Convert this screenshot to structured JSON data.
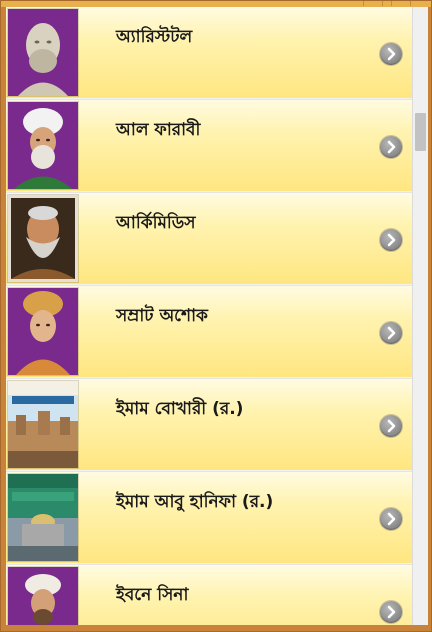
{
  "list": {
    "items": [
      {
        "label": "অ্যারিস্টটল",
        "thumb": "statue-portrait"
      },
      {
        "label": "আল ফারাবী",
        "thumb": "turban-portrait"
      },
      {
        "label": "আর্কিমিডিস",
        "thumb": "bearded-portrait"
      },
      {
        "label": "সম্রাট অশোক",
        "thumb": "emperor-portrait"
      },
      {
        "label": "ইমাম বোখারী (র.)",
        "thumb": "book-cover-city"
      },
      {
        "label": "ইমাম আবু হানিফা (র.)",
        "thumb": "book-cover-mosque"
      },
      {
        "label": "ইবনে সিনা",
        "thumb": "turban-portrait-small"
      }
    ],
    "chevron_icon": "chevron-right-icon"
  },
  "colors": {
    "row_gradient_top": "#fffbe2",
    "row_gradient_bottom": "#ffe680",
    "window_frame": "#c9823a",
    "purple_bg": "#7a2a8c"
  }
}
